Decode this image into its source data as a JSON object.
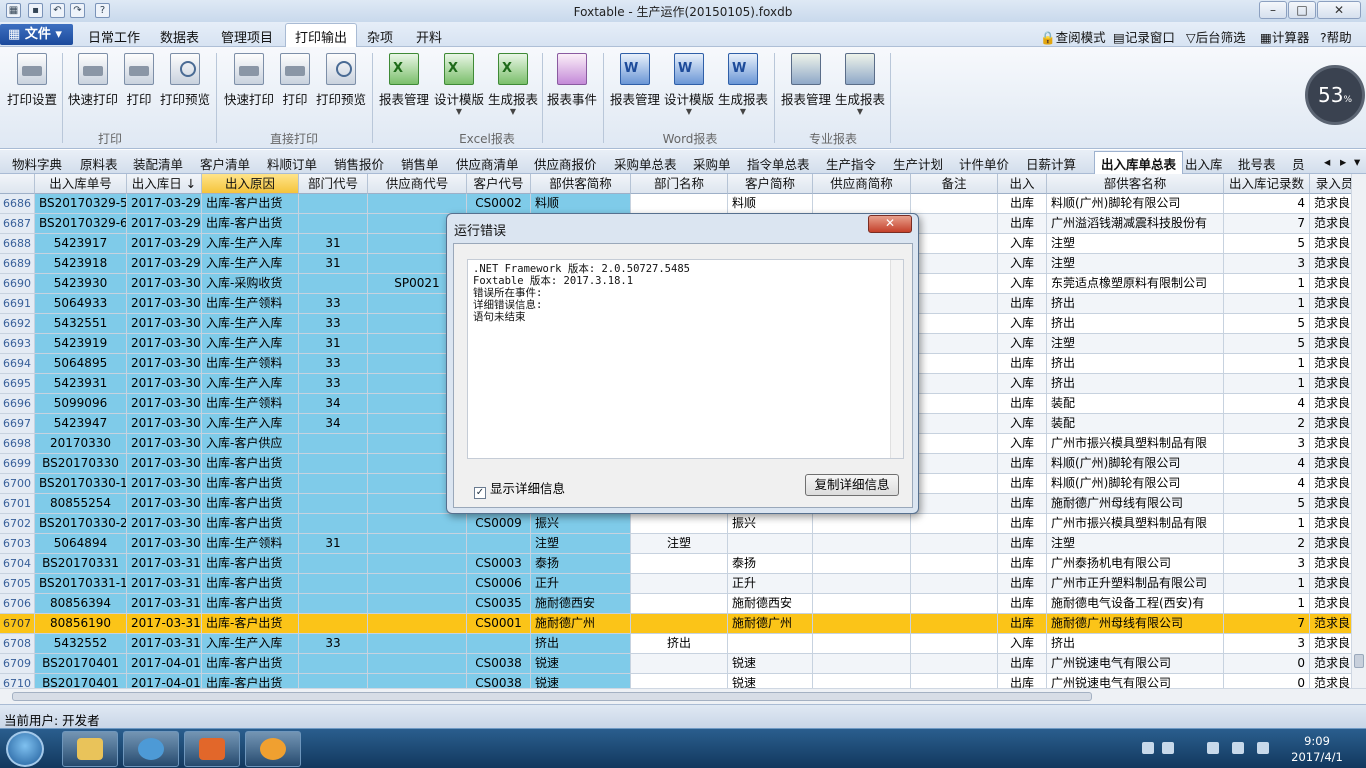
{
  "window": {
    "title": "Foxtable - 生产运作(20150105).foxdb",
    "min": "–",
    "max": "□",
    "close": "✕"
  },
  "menu": {
    "file": "文件",
    "tabs": [
      "日常工作",
      "数据表",
      "管理项目",
      "打印输出",
      "杂项",
      "开料"
    ],
    "active_tab": "打印输出",
    "right": [
      "查阅模式",
      "记录窗口",
      "后台筛选",
      "计算器",
      "帮助"
    ]
  },
  "ribbon": {
    "buttons": [
      "打印设置",
      "快速打印",
      "打印",
      "打印预览",
      "快速打印",
      "打印",
      "打印预览",
      "报表管理",
      "设计模版",
      "生成报表",
      "报表事件",
      "报表管理",
      "设计模版",
      "生成报表",
      "报表管理",
      "生成报表"
    ],
    "groups": [
      "打印",
      "直接打印",
      "Excel报表",
      "Word报表",
      "专业报表"
    ]
  },
  "gauge": {
    "value": "53",
    "unit": "%"
  },
  "table_tabs": [
    "物料字典",
    "原料表",
    "装配清单",
    "客户清单",
    "料顺订单",
    "销售报价",
    "销售单",
    "供应商清单",
    "供应商报价",
    "采购单总表",
    "采购单",
    "指令单总表",
    "生产指令",
    "生产计划",
    "计件单价",
    "日薪计算",
    "出入库单总表",
    "出入库",
    "批号表",
    "员"
  ],
  "active_table_tab": "出入库单总表",
  "grid": {
    "columns": [
      "出入库单号",
      "出入库日 ↓",
      "出入原因",
      "部门代号",
      "供应商代号",
      "客户代号",
      "部供客简称",
      "部门名称",
      "客户简称",
      "供应商简称",
      "备注",
      "出入",
      "部供客名称",
      "出入库记录数",
      "录入员"
    ],
    "rows": [
      [
        "6686",
        "BS20170329-5",
        "2017-03-29",
        "出库-客户出货",
        "",
        "",
        "CS0002",
        "料顺",
        "",
        "料顺",
        "",
        "",
        "出库",
        "料顺(广州)脚轮有限公司",
        "4",
        "范求良"
      ],
      [
        "6687",
        "BS20170329-6",
        "2017-03-29",
        "出库-客户出货",
        "",
        "",
        "",
        "",
        "",
        "",
        "",
        "",
        "出库",
        "广州溢滔钱潮减震科技股份有",
        "7",
        "范求良"
      ],
      [
        "6688",
        "5423917",
        "2017-03-29",
        "入库-生产入库",
        "31",
        "",
        "",
        "",
        "",
        "",
        "",
        "",
        "入库",
        "注塑",
        "5",
        "范求良"
      ],
      [
        "6689",
        "5423918",
        "2017-03-29",
        "入库-生产入库",
        "31",
        "",
        "",
        "",
        "",
        "",
        "",
        "",
        "入库",
        "注塑",
        "3",
        "范求良"
      ],
      [
        "6690",
        "5423930",
        "2017-03-30",
        "入库-采购收货",
        "",
        "SP0021",
        "",
        "",
        "",
        "",
        "",
        "",
        "入库",
        "东莞适点橡塑原料有限制公司",
        "1",
        "范求良"
      ],
      [
        "6691",
        "5064933",
        "2017-03-30",
        "出库-生产领料",
        "33",
        "",
        "",
        "",
        "",
        "",
        "",
        "",
        "出库",
        "挤出",
        "1",
        "范求良"
      ],
      [
        "6692",
        "5432551",
        "2017-03-30",
        "入库-生产入库",
        "33",
        "",
        "",
        "",
        "",
        "",
        "",
        "",
        "入库",
        "挤出",
        "5",
        "范求良"
      ],
      [
        "6693",
        "5423919",
        "2017-03-30",
        "入库-生产入库",
        "31",
        "",
        "",
        "",
        "",
        "",
        "",
        "",
        "入库",
        "注塑",
        "5",
        "范求良"
      ],
      [
        "6694",
        "5064895",
        "2017-03-30",
        "出库-生产领料",
        "33",
        "",
        "",
        "",
        "",
        "",
        "",
        "",
        "出库",
        "挤出",
        "1",
        "范求良"
      ],
      [
        "6695",
        "5423931",
        "2017-03-30",
        "入库-生产入库",
        "33",
        "",
        "",
        "",
        "",
        "",
        "",
        "",
        "入库",
        "挤出",
        "1",
        "范求良"
      ],
      [
        "6696",
        "5099096",
        "2017-03-30",
        "出库-生产领料",
        "34",
        "",
        "",
        "",
        "",
        "",
        "",
        "",
        "出库",
        "装配",
        "4",
        "范求良"
      ],
      [
        "6697",
        "5423947",
        "2017-03-30",
        "入库-生产入库",
        "34",
        "",
        "",
        "",
        "",
        "",
        "",
        "",
        "入库",
        "装配",
        "2",
        "范求良"
      ],
      [
        "6698",
        "20170330",
        "2017-03-30",
        "入库-客户供应",
        "",
        "",
        "",
        "",
        "",
        "",
        "",
        "",
        "入库",
        "广州市振兴模具塑料制品有限",
        "3",
        "范求良"
      ],
      [
        "6699",
        "BS20170330",
        "2017-03-30",
        "出库-客户出货",
        "",
        "",
        "",
        "",
        "",
        "",
        "",
        "",
        "出库",
        "料顺(广州)脚轮有限公司",
        "4",
        "范求良"
      ],
      [
        "6700",
        "BS20170330-1",
        "2017-03-30",
        "出库-客户出货",
        "",
        "",
        "",
        "",
        "",
        "",
        "",
        "",
        "出库",
        "料顺(广州)脚轮有限公司",
        "4",
        "范求良"
      ],
      [
        "6701",
        "80855254",
        "2017-03-30",
        "出库-客户出货",
        "",
        "",
        "",
        "",
        "",
        "",
        "",
        "",
        "出库",
        "施耐德广州母线有限公司",
        "5",
        "范求良"
      ],
      [
        "6702",
        "BS20170330-2",
        "2017-03-30",
        "出库-客户出货",
        "",
        "",
        "CS0009",
        "振兴",
        "",
        "振兴",
        "",
        "",
        "出库",
        "广州市振兴模具塑料制品有限",
        "1",
        "范求良"
      ],
      [
        "6703",
        "5064894",
        "2017-03-30",
        "出库-生产领料",
        "31",
        "",
        "",
        "注塑",
        "注塑",
        "",
        "",
        "",
        "出库",
        "注塑",
        "2",
        "范求良"
      ],
      [
        "6704",
        "BS20170331",
        "2017-03-31",
        "出库-客户出货",
        "",
        "",
        "CS0003",
        "泰扬",
        "",
        "泰扬",
        "",
        "",
        "出库",
        "广州泰扬机电有限公司",
        "3",
        "范求良"
      ],
      [
        "6705",
        "BS20170331-1",
        "2017-03-31",
        "出库-客户出货",
        "",
        "",
        "CS0006",
        "正升",
        "",
        "正升",
        "",
        "",
        "出库",
        "广州市正升塑料制品有限公司",
        "1",
        "范求良"
      ],
      [
        "6706",
        "80856394",
        "2017-03-31",
        "出库-客户出货",
        "",
        "",
        "CS0035",
        "施耐德西安",
        "",
        "施耐德西安",
        "",
        "",
        "出库",
        "施耐德电气设备工程(西安)有",
        "1",
        "范求良"
      ],
      [
        "6707",
        "80856190",
        "2017-03-31",
        "出库-客户出货",
        "",
        "",
        "CS0001",
        "施耐德广州",
        "",
        "施耐德广州",
        "",
        "",
        "出库",
        "施耐德广州母线有限公司",
        "7",
        "范求良"
      ],
      [
        "6708",
        "5432552",
        "2017-03-31",
        "入库-生产入库",
        "33",
        "",
        "",
        "挤出",
        "挤出",
        "",
        "",
        "",
        "入库",
        "挤出",
        "3",
        "范求良"
      ],
      [
        "6709",
        "BS20170401",
        "2017-04-01",
        "出库-客户出货",
        "",
        "",
        "CS0038",
        "锐速",
        "",
        "锐速",
        "",
        "",
        "出库",
        "广州锐速电气有限公司",
        "0",
        "范求良"
      ],
      [
        "6710",
        "BS20170401",
        "2017-04-01",
        "出库-客户出货",
        "",
        "",
        "CS0038",
        "锐速",
        "",
        "锐速",
        "",
        "",
        "出库",
        "广州锐速电气有限公司",
        "0",
        "范求良"
      ]
    ],
    "highlight_row": "6707"
  },
  "dialog": {
    "title": "运行错误",
    "lines": [
      ".NET Framework 版本: 2.0.50727.5485",
      "Foxtable 版本: 2017.3.18.1",
      "错误所在事件:",
      "详细错误信息:",
      "语句未结束"
    ],
    "checkbox_label": "显示详细信息",
    "checkbox_checked": "✓",
    "copy_button": "复制详细信息",
    "close": "✕"
  },
  "status": {
    "user": "当前用户:  开发者"
  },
  "taskbar": {
    "time": "9:09",
    "date": "2017/4/1"
  }
}
